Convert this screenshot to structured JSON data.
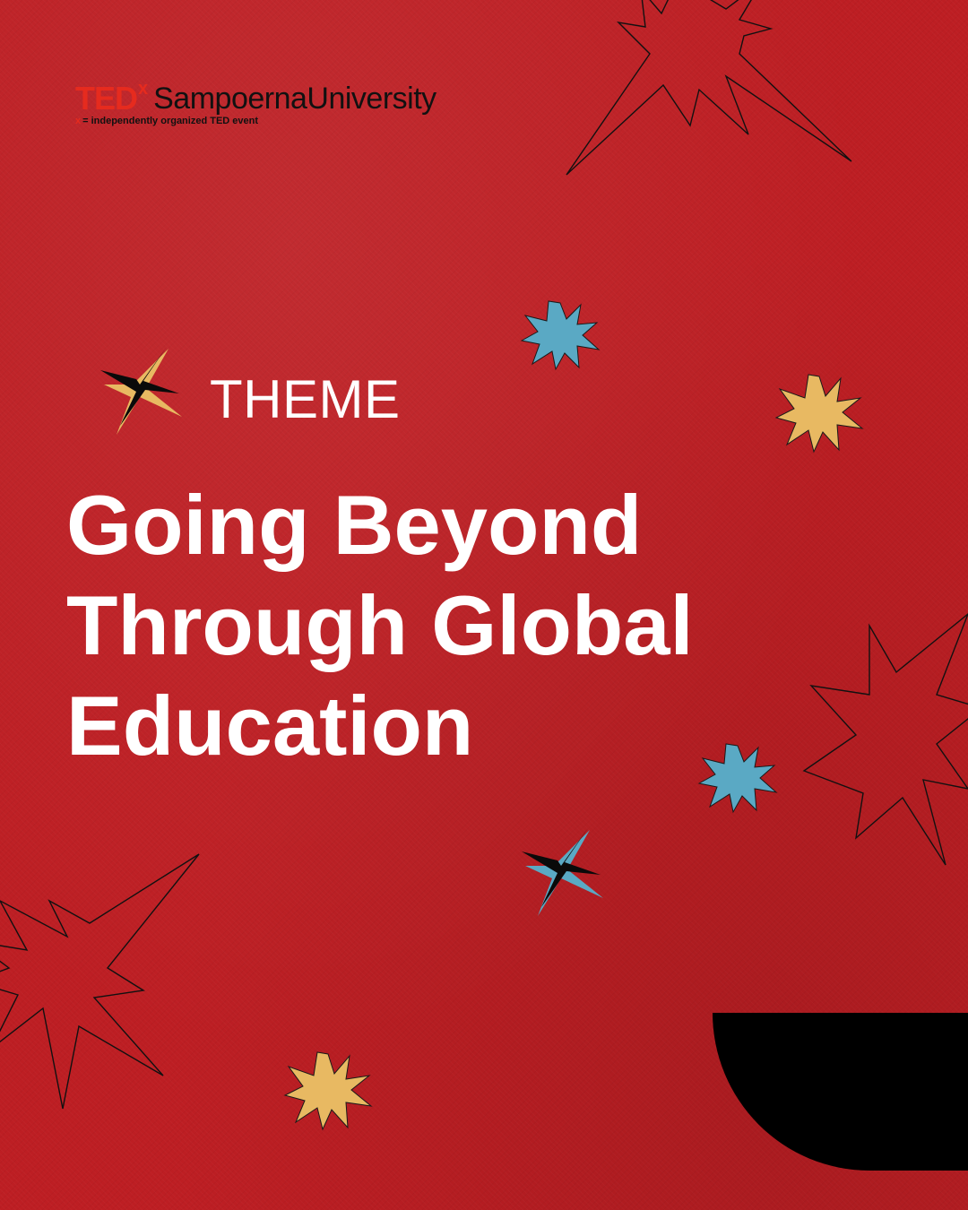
{
  "logo": {
    "ted": "TED",
    "x": "x",
    "organizer": "SampoernaUniversity",
    "tagline_x": "x",
    "tagline": "= independently organized TED event"
  },
  "theme": {
    "label": "THEME",
    "title_lines": [
      "Going Beyond",
      "Through Global",
      "Education"
    ]
  },
  "colors": {
    "background": "#bd1e23",
    "text": "#ffffff",
    "ted_red": "#e62b1e",
    "accent_blue": "#5aa9c4",
    "accent_yellow": "#e8b962",
    "black": "#000000"
  }
}
